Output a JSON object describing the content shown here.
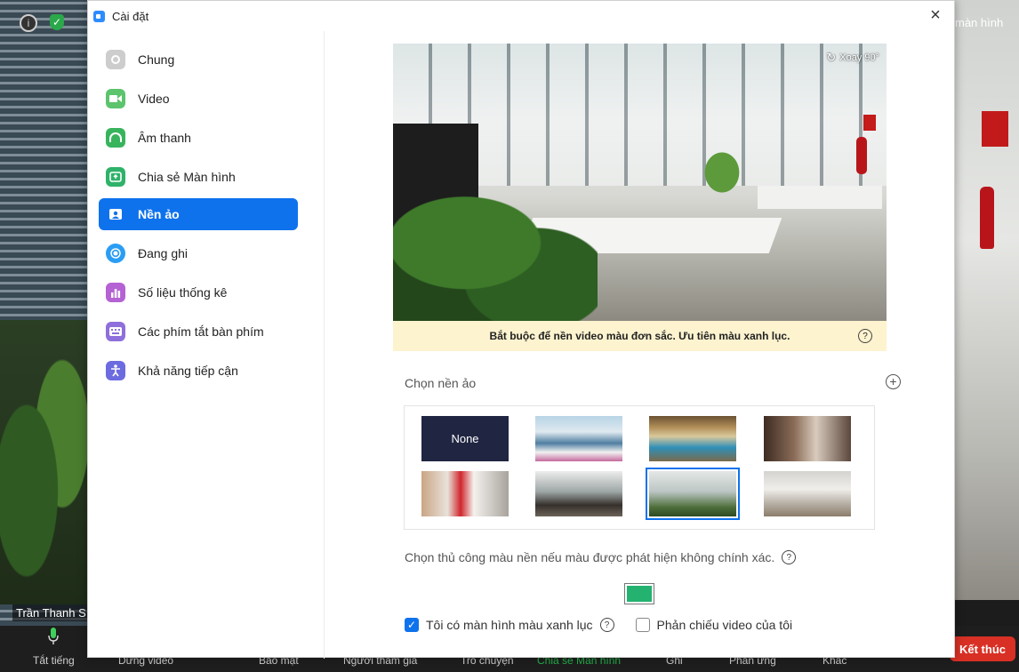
{
  "meeting": {
    "participant_name": "Trần Thanh S",
    "right_label": "màn hình",
    "toolbar": {
      "mute": "Tắt tiếng",
      "stop_video": "Dừng video",
      "security": "Bảo mật",
      "participants": "Người tham gia",
      "chat": "Trò chuyện",
      "share_screen": "Chia sẻ Màn hình",
      "record": "Ghi",
      "reactions": "Phản ứng",
      "more": "Khác",
      "end": "Kết thúc"
    },
    "colors": {
      "share_active": "#24b24a",
      "end": "#d93025"
    }
  },
  "dialog": {
    "title": "Cài đặt",
    "close": "×"
  },
  "sidebar": {
    "items": [
      {
        "label": "Chung",
        "icon": "gear-icon",
        "color": "#c8c8c8"
      },
      {
        "label": "Video",
        "icon": "video-camera-icon",
        "color": "#5bc46c"
      },
      {
        "label": "Âm thanh",
        "icon": "headphones-icon",
        "color": "#37b45c"
      },
      {
        "label": "Chia sẻ Màn hình",
        "icon": "share-screen-icon",
        "color": "#2fb26a"
      },
      {
        "label": "Nền ảo",
        "icon": "portrait-icon",
        "color": "#ffffff",
        "active": true
      },
      {
        "label": "Đang ghi",
        "icon": "record-icon",
        "color": "#2a9df4"
      },
      {
        "label": "Số liệu thống kê",
        "icon": "bar-chart-icon",
        "color": "#b462d4"
      },
      {
        "label": "Các phím tắt bàn phím",
        "icon": "keyboard-icon",
        "color": "#8e6fdb"
      },
      {
        "label": "Khả năng tiếp cận",
        "icon": "accessibility-icon",
        "color": "#6c6be0"
      }
    ]
  },
  "virtual_background": {
    "rotate_label": "Xoay 90°",
    "notice": "Bắt buộc để nền video màu đơn sắc. Ưu tiên màu xanh lục.",
    "choose_label": "Chọn nền ảo",
    "thumbnails": [
      {
        "label": "None"
      },
      {
        "name": "thumb-bay"
      },
      {
        "name": "thumb-patio"
      },
      {
        "name": "thumb-lounge"
      },
      {
        "name": "thumb-office-desk"
      },
      {
        "name": "thumb-office-room"
      },
      {
        "name": "thumb-office-plants",
        "selected": true
      },
      {
        "name": "thumb-living-room"
      }
    ],
    "manual_label": "Chọn thủ công màu nền nếu màu được phát hiện không chính xác.",
    "swatch_color": "#24b271",
    "green_screen_label": "Tôi có màn hình màu xanh lục",
    "green_screen_checked": true,
    "mirror_label": "Phản chiếu video của tôi",
    "mirror_checked": false
  }
}
